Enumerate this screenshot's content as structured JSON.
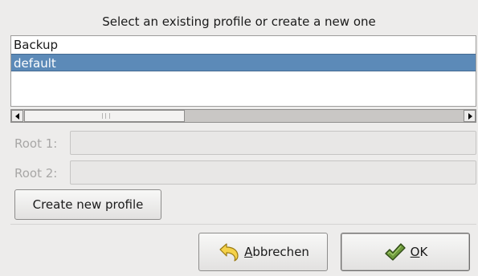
{
  "dialog": {
    "title": "Select an existing profile or create a new one"
  },
  "profiles": {
    "items": [
      {
        "label": "Backup",
        "selected": false
      },
      {
        "label": "default",
        "selected": true
      }
    ]
  },
  "fields": {
    "root1_label": "Root 1:",
    "root1_value": "",
    "root2_label": "Root 2:",
    "root2_value": ""
  },
  "buttons": {
    "create_label": "Create new profile",
    "cancel_mnemonic": "A",
    "cancel_rest": "bbrechen",
    "ok_mnemonic": "O",
    "ok_rest": "K"
  },
  "icons": {
    "cancel": "undo-arrow-icon",
    "ok": "checkmark-icon"
  },
  "colors": {
    "selection": "#5c8ab8",
    "background": "#edeceb"
  }
}
